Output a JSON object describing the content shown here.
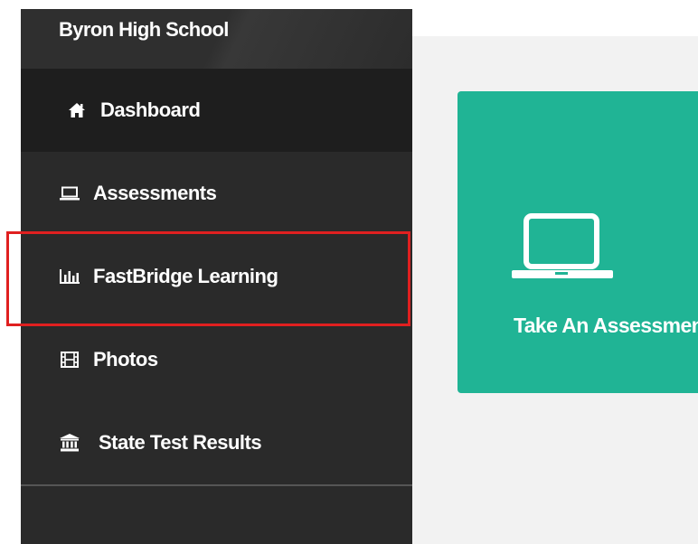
{
  "sidebar": {
    "school_name": "Byron High School",
    "items": [
      {
        "label": "Dashboard",
        "icon": "home-icon",
        "active": true
      },
      {
        "label": "Assessments",
        "icon": "laptop-icon",
        "active": false
      },
      {
        "label": "FastBridge Learning",
        "icon": "bar-chart-icon",
        "active": false,
        "highlighted": true
      },
      {
        "label": "Photos",
        "icon": "film-icon",
        "active": false
      },
      {
        "label": "State Test Results",
        "icon": "bank-icon",
        "active": false
      }
    ]
  },
  "main": {
    "card": {
      "label": "Take An Assessment",
      "icon": "laptop-icon"
    }
  },
  "colors": {
    "sidebar_bg": "#2a2a2a",
    "active_item_bg": "#1e1e1e",
    "card_bg": "#20b495",
    "highlight_border": "#e02020",
    "main_bg": "#f2f2f2"
  }
}
